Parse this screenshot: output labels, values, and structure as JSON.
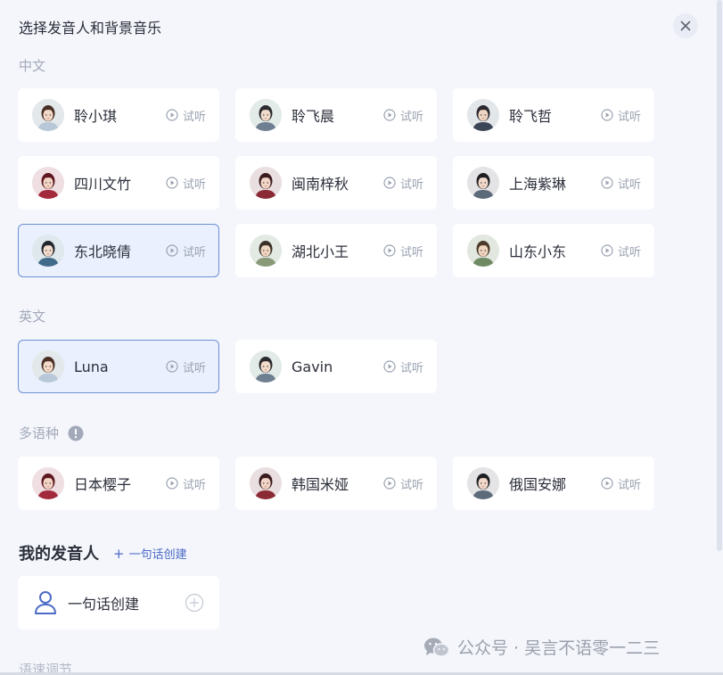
{
  "dialog": {
    "title": "选择发音人和背景音乐"
  },
  "sections": {
    "chinese": {
      "label": "中文",
      "voices": [
        {
          "name": "聆小琪",
          "listen": "试听",
          "selected": false
        },
        {
          "name": "聆飞晨",
          "listen": "试听",
          "selected": false
        },
        {
          "name": "聆飞哲",
          "listen": "试听",
          "selected": false
        },
        {
          "name": "四川文竹",
          "listen": "试听",
          "selected": false
        },
        {
          "name": "闽南梓秋",
          "listen": "试听",
          "selected": false
        },
        {
          "name": "上海紫琳",
          "listen": "试听",
          "selected": false
        },
        {
          "name": "东北晓倩",
          "listen": "试听",
          "selected": true
        },
        {
          "name": "湖北小王",
          "listen": "试听",
          "selected": false
        },
        {
          "name": "山东小东",
          "listen": "试听",
          "selected": false
        }
      ]
    },
    "english": {
      "label": "英文",
      "voices": [
        {
          "name": "Luna",
          "listen": "试听",
          "selected": true
        },
        {
          "name": "Gavin",
          "listen": "试听",
          "selected": false
        }
      ]
    },
    "multilingual": {
      "label": "多语种",
      "voices": [
        {
          "name": "日本樱子",
          "listen": "试听",
          "selected": false
        },
        {
          "name": "韩国米娅",
          "listen": "试听",
          "selected": false
        },
        {
          "name": "俄国安娜",
          "listen": "试听",
          "selected": false
        }
      ]
    }
  },
  "my_voices": {
    "title": "我的发音人",
    "create_link": "一句话创建",
    "create_card_label": "一句话创建"
  },
  "speed": {
    "label": "语速调节"
  },
  "watermark": {
    "text": "公众号 · 吴言不语零一二三"
  },
  "colors": {
    "accent": "#4b6bc6",
    "selected_bg": "#eaf0fd",
    "selected_border": "#6e8fd6",
    "background": "#f4f6fc"
  }
}
